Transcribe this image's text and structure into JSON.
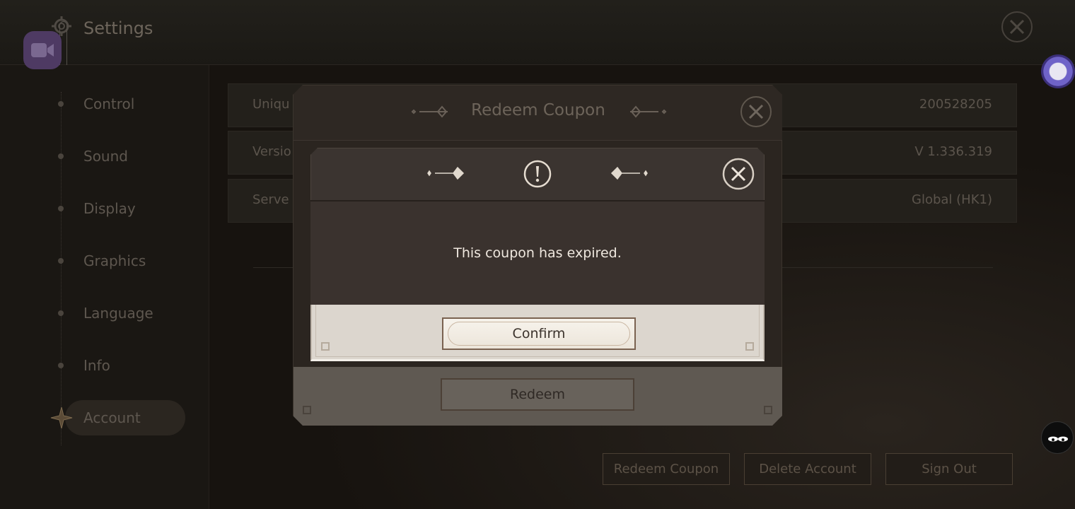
{
  "header": {
    "title": "Settings"
  },
  "sidebar": {
    "items": [
      {
        "label": "Control"
      },
      {
        "label": "Sound"
      },
      {
        "label": "Display"
      },
      {
        "label": "Graphics"
      },
      {
        "label": "Language"
      },
      {
        "label": "Info"
      },
      {
        "label": "Account",
        "active": true
      }
    ]
  },
  "info": {
    "rows": [
      {
        "label": "Uniqu",
        "value": "200528205"
      },
      {
        "label": "Versio",
        "value": "V 1.336.319"
      },
      {
        "label": "Serve",
        "value": "Global (HK1)"
      }
    ]
  },
  "account_buttons": {
    "redeem_coupon": "Redeem Coupon",
    "delete_account": "Delete Account",
    "sign_out": "Sign Out"
  },
  "coupon_dialog": {
    "title": "Redeem Coupon",
    "redeem_label": "Redeem"
  },
  "alert": {
    "message": "This coupon has expired.",
    "confirm_label": "Confirm"
  },
  "icons": {
    "top_close": "close-icon",
    "record": "video-camera-icon",
    "alert": "exclamation-icon",
    "floating_assistant": "floating-ball-icon",
    "mascot": "mascot-icon"
  },
  "colors": {
    "accent_purple": "#4e3a63",
    "alert_message": "#efe8df",
    "confirm_border": "#7a6250"
  }
}
